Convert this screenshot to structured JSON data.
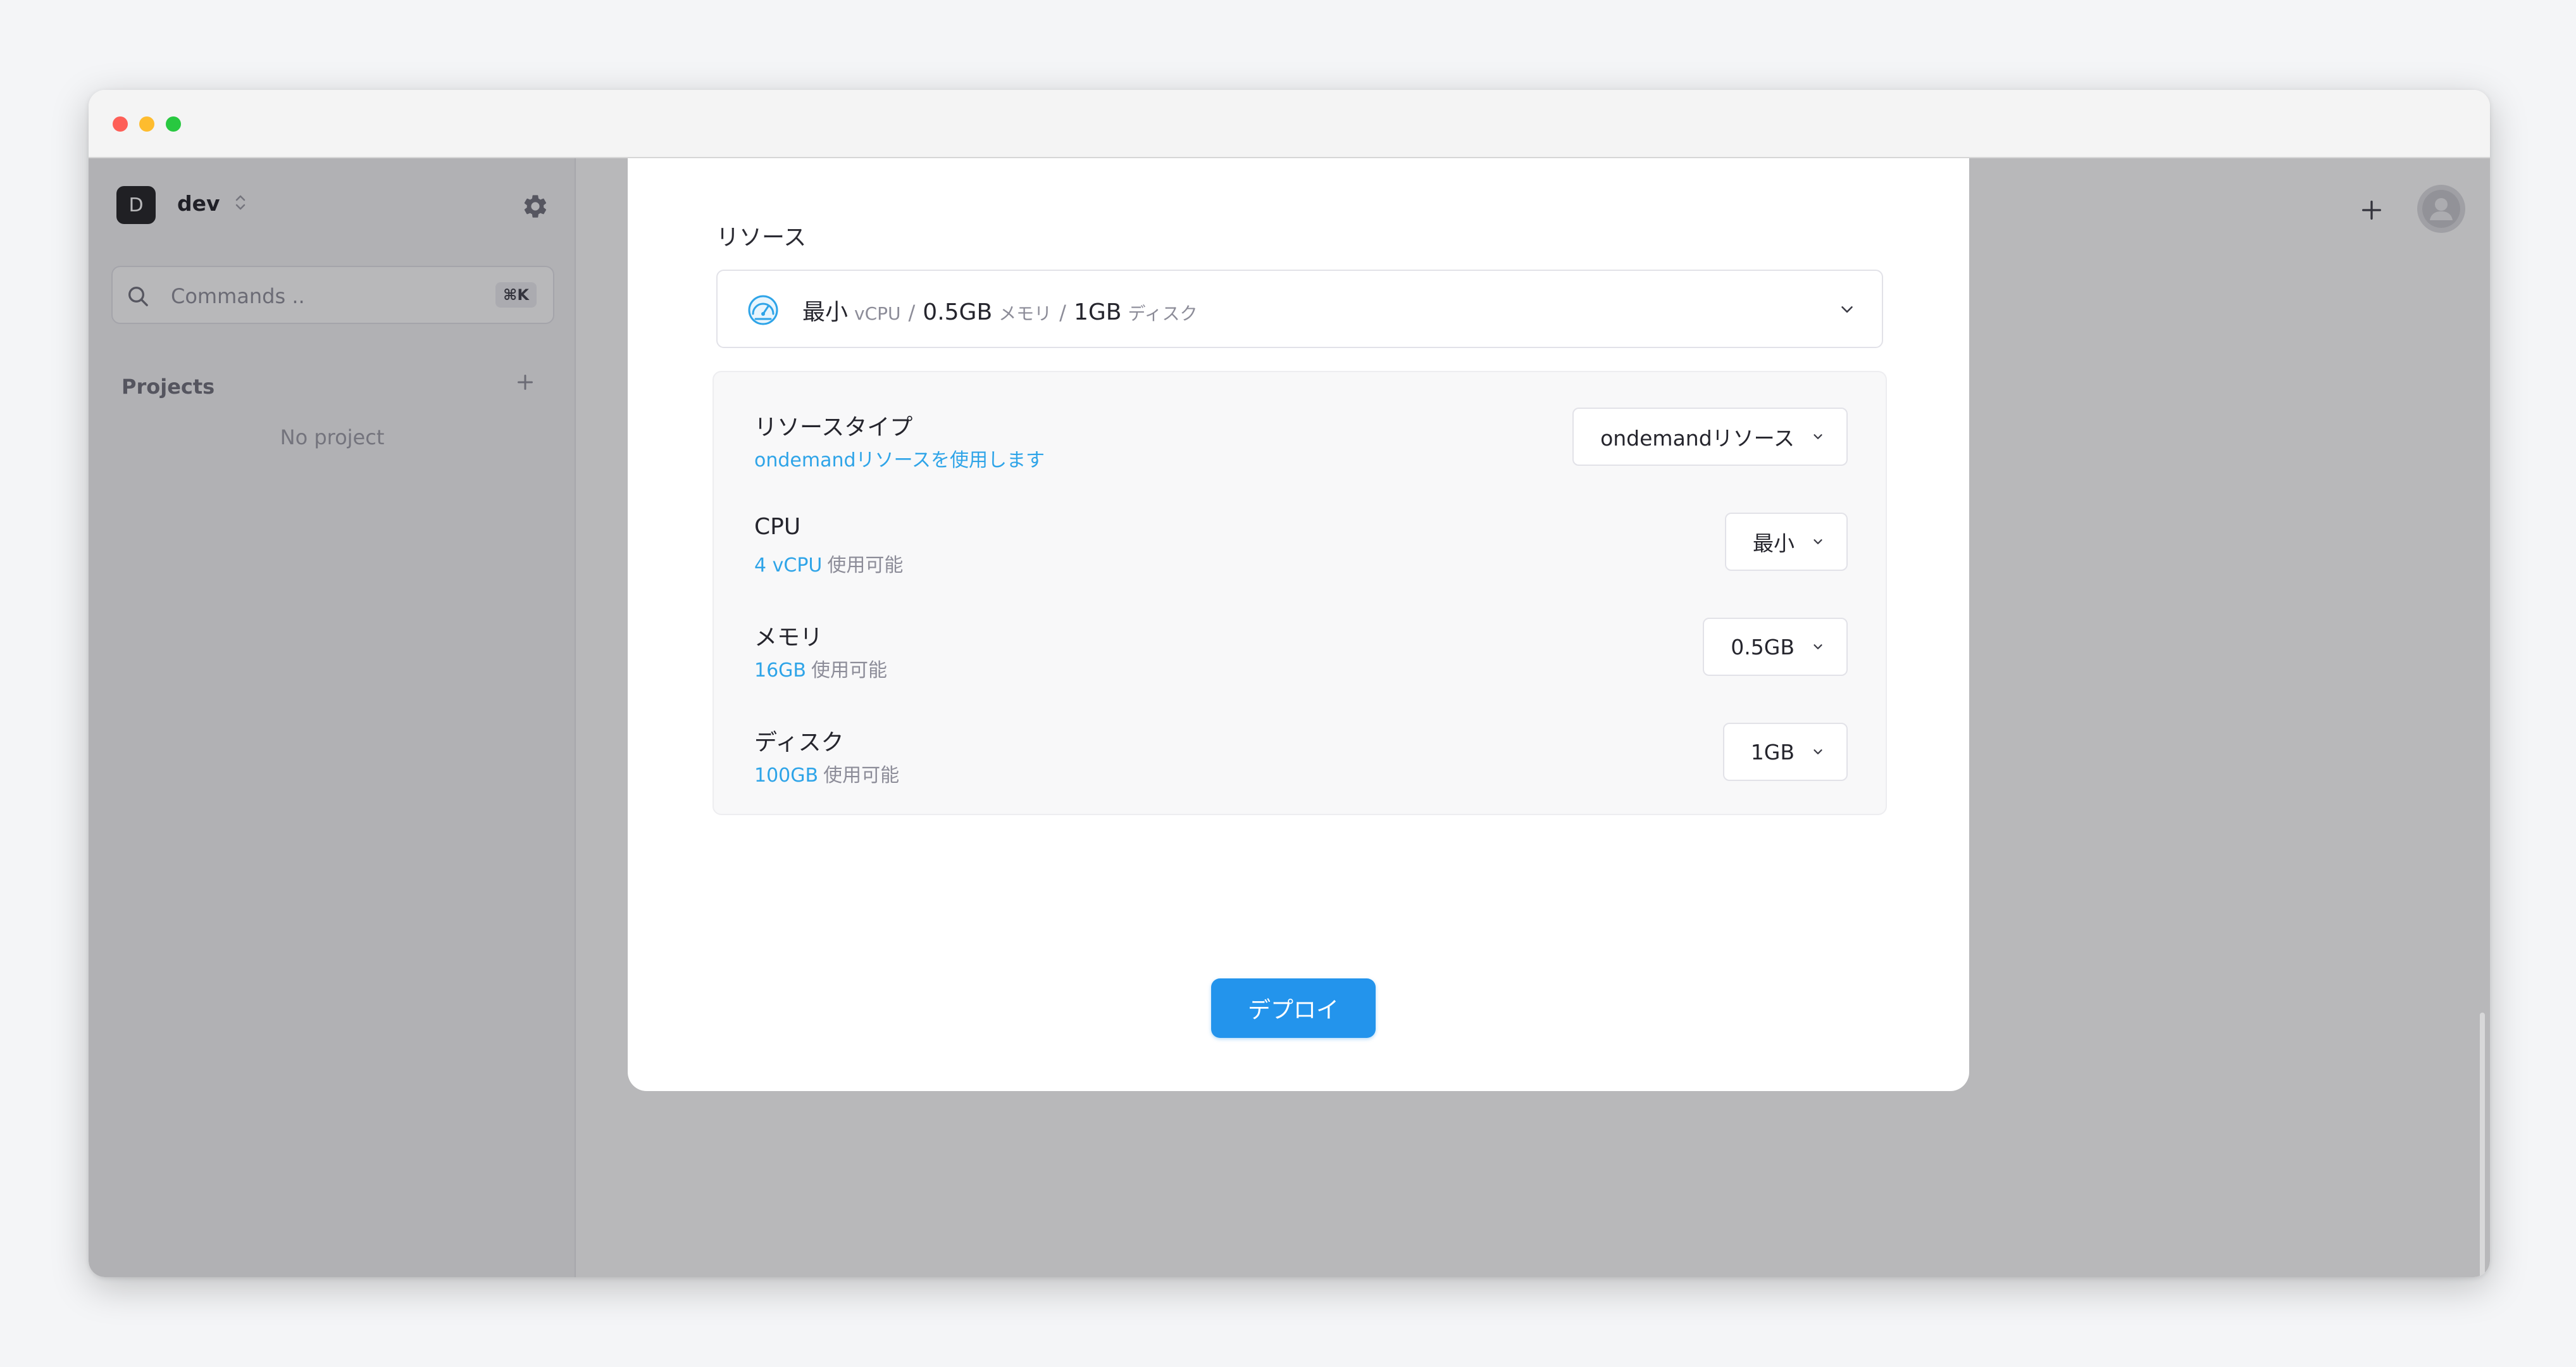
{
  "sidebar": {
    "workspace_initial": "D",
    "workspace_name": "dev",
    "search_placeholder": "Commands ..",
    "search_shortcut": "⌘K",
    "projects_title": "Projects",
    "empty_projects": "No project"
  },
  "modal": {
    "section_label": "リソース",
    "summary": {
      "cpu_value": "最小",
      "cpu_unit": "vCPU",
      "separator": "/",
      "memory_value": "0.5GB",
      "memory_unit": "メモリ",
      "disk_value": "1GB",
      "disk_unit": "ディスク"
    },
    "rows": [
      {
        "title": "リソースタイプ",
        "subtitle_highlight": "ondemandリソースを使用します",
        "subtitle_muted": "",
        "value": "ondemandリソース"
      },
      {
        "title": "CPU",
        "subtitle_highlight": "4 vCPU",
        "subtitle_muted": "使用可能",
        "value": "最小"
      },
      {
        "title": "メモリ",
        "subtitle_highlight": "16GB",
        "subtitle_muted": "使用可能",
        "value": "0.5GB"
      },
      {
        "title": "ディスク",
        "subtitle_highlight": "100GB",
        "subtitle_muted": "使用可能",
        "value": "1GB"
      }
    ],
    "deploy_label": "デプロイ"
  },
  "colors": {
    "accent": "#2394ec",
    "highlight_text": "#2ea4e8",
    "overlay": "#28282e"
  },
  "icons": {
    "gauge": "speedometer-icon",
    "settings": "gear-icon",
    "search": "search-icon",
    "add": "plus-icon",
    "dropdown": "chevron-down-icon",
    "user": "user-avatar-icon"
  }
}
